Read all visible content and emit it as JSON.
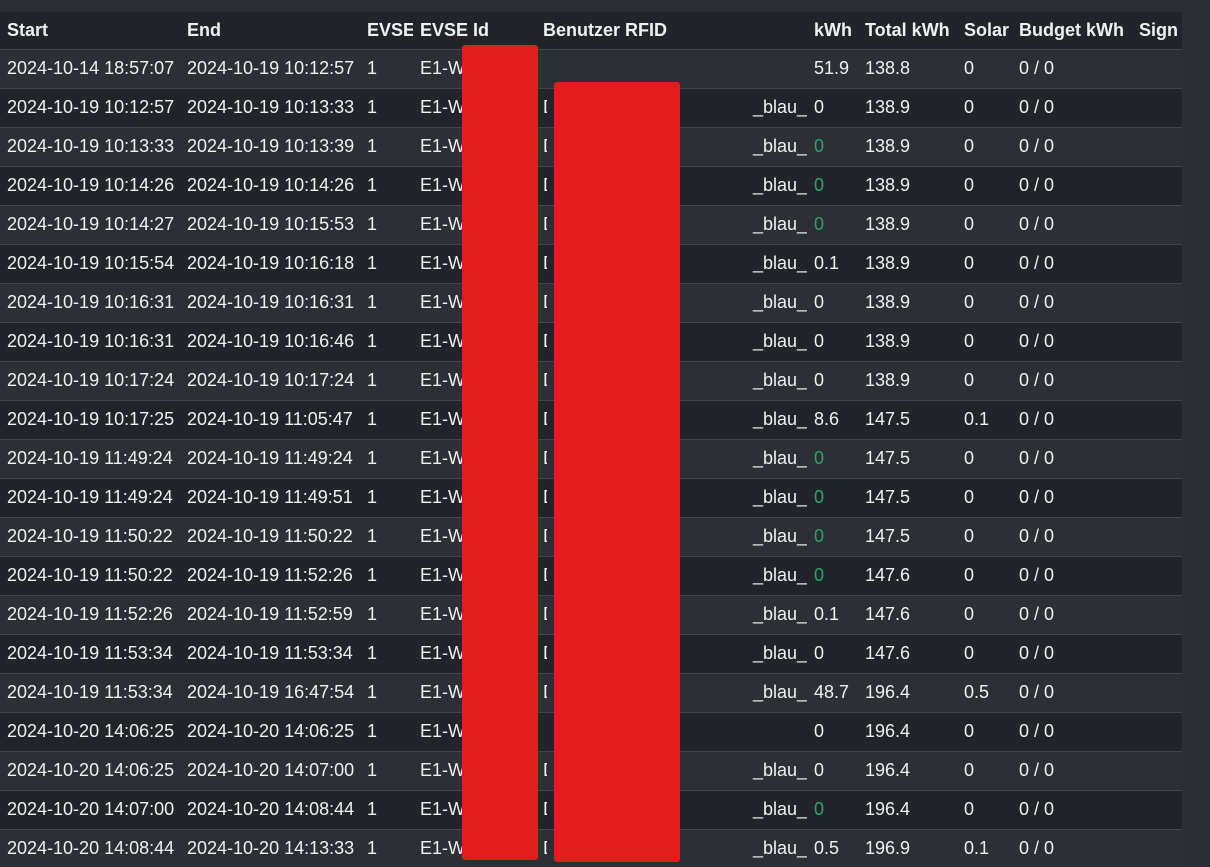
{
  "headers": {
    "start": "Start",
    "end": "End",
    "evse": "EVSE",
    "evse_id": "EVSE Id",
    "user_rfid": "Benutzer RFID",
    "kwh": "kWh",
    "total_kwh": "Total kWh",
    "solar": "Solar",
    "budget_kwh": "Budget kWh",
    "sign": "Sign"
  },
  "rows": [
    {
      "start": "2024-10-14 18:57:07",
      "end": "2024-10-19 10:12:57",
      "evse": "1",
      "evse_id": "E1-W",
      "rfid_a": "",
      "rfid_b": "",
      "kwh": "51.9",
      "total": "138.8",
      "solar": "0",
      "budget": "0 / 0",
      "sign": ""
    },
    {
      "start": "2024-10-19 10:12:57",
      "end": "2024-10-19 10:13:33",
      "evse": "1",
      "evse_id": "E1-W",
      "rfid_a": "D",
      "rfid_b": "_blau_",
      "kwh": "0",
      "total": "138.9",
      "solar": "0",
      "budget": "0 / 0",
      "sign": ""
    },
    {
      "start": "2024-10-19 10:13:33",
      "end": "2024-10-19 10:13:39",
      "evse": "1",
      "evse_id": "E1-W",
      "rfid_a": "D",
      "rfid_b": "_blau_",
      "kwh": "0",
      "kwh_green": true,
      "total": "138.9",
      "solar": "0",
      "budget": "0 / 0",
      "sign": ""
    },
    {
      "start": "2024-10-19 10:14:26",
      "end": "2024-10-19 10:14:26",
      "evse": "1",
      "evse_id": "E1-W",
      "rfid_a": "D",
      "rfid_b": "_blau_",
      "kwh": "0",
      "kwh_green": true,
      "total": "138.9",
      "solar": "0",
      "budget": "0 / 0",
      "sign": ""
    },
    {
      "start": "2024-10-19 10:14:27",
      "end": "2024-10-19 10:15:53",
      "evse": "1",
      "evse_id": "E1-W",
      "rfid_a": "D",
      "rfid_b": "_blau_",
      "kwh": "0",
      "kwh_green": true,
      "total": "138.9",
      "solar": "0",
      "budget": "0 / 0",
      "sign": ""
    },
    {
      "start": "2024-10-19 10:15:54",
      "end": "2024-10-19 10:16:18",
      "evse": "1",
      "evse_id": "E1-W",
      "rfid_a": "D",
      "rfid_b": "_blau_",
      "kwh": "0.1",
      "total": "138.9",
      "solar": "0",
      "budget": "0 / 0",
      "sign": ""
    },
    {
      "start": "2024-10-19 10:16:31",
      "end": "2024-10-19 10:16:31",
      "evse": "1",
      "evse_id": "E1-W",
      "rfid_a": "D",
      "rfid_b": "_blau_",
      "kwh": "0",
      "total": "138.9",
      "solar": "0",
      "budget": "0 / 0",
      "sign": ""
    },
    {
      "start": "2024-10-19 10:16:31",
      "end": "2024-10-19 10:16:46",
      "evse": "1",
      "evse_id": "E1-W",
      "rfid_a": "D",
      "rfid_b": "_blau_",
      "kwh": "0",
      "total": "138.9",
      "solar": "0",
      "budget": "0 / 0",
      "sign": ""
    },
    {
      "start": "2024-10-19 10:17:24",
      "end": "2024-10-19 10:17:24",
      "evse": "1",
      "evse_id": "E1-W",
      "rfid_a": "D",
      "rfid_b": "_blau_",
      "kwh": "0",
      "total": "138.9",
      "solar": "0",
      "budget": "0 / 0",
      "sign": ""
    },
    {
      "start": "2024-10-19 10:17:25",
      "end": "2024-10-19 11:05:47",
      "evse": "1",
      "evse_id": "E1-W",
      "rfid_a": "D",
      "rfid_b": "_blau_",
      "kwh": "8.6",
      "total": "147.5",
      "solar": "0.1",
      "budget": "0 / 0",
      "sign": ""
    },
    {
      "start": "2024-10-19 11:49:24",
      "end": "2024-10-19 11:49:24",
      "evse": "1",
      "evse_id": "E1-W",
      "rfid_a": "D",
      "rfid_b": "_blau_",
      "kwh": "0",
      "kwh_green": true,
      "total": "147.5",
      "solar": "0",
      "budget": "0 / 0",
      "sign": ""
    },
    {
      "start": "2024-10-19 11:49:24",
      "end": "2024-10-19 11:49:51",
      "evse": "1",
      "evse_id": "E1-W",
      "rfid_a": "D",
      "rfid_b": "_blau_",
      "kwh": "0",
      "kwh_green": true,
      "total": "147.5",
      "solar": "0",
      "budget": "0 / 0",
      "sign": ""
    },
    {
      "start": "2024-10-19 11:50:22",
      "end": "2024-10-19 11:50:22",
      "evse": "1",
      "evse_id": "E1-W",
      "rfid_a": "D",
      "rfid_b": "_blau_",
      "kwh": "0",
      "kwh_green": true,
      "total": "147.5",
      "solar": "0",
      "budget": "0 / 0",
      "sign": ""
    },
    {
      "start": "2024-10-19 11:50:22",
      "end": "2024-10-19 11:52:26",
      "evse": "1",
      "evse_id": "E1-W",
      "rfid_a": "D",
      "rfid_b": "_blau_",
      "kwh": "0",
      "kwh_green": true,
      "total": "147.6",
      "solar": "0",
      "budget": "0 / 0",
      "sign": ""
    },
    {
      "start": "2024-10-19 11:52:26",
      "end": "2024-10-19 11:52:59",
      "evse": "1",
      "evse_id": "E1-W",
      "rfid_a": "D",
      "rfid_b": "_blau_",
      "kwh": "0.1",
      "total": "147.6",
      "solar": "0",
      "budget": "0 / 0",
      "sign": ""
    },
    {
      "start": "2024-10-19 11:53:34",
      "end": "2024-10-19 11:53:34",
      "evse": "1",
      "evse_id": "E1-W",
      "rfid_a": "D",
      "rfid_b": "_blau_",
      "kwh": "0",
      "total": "147.6",
      "solar": "0",
      "budget": "0 / 0",
      "sign": ""
    },
    {
      "start": "2024-10-19 11:53:34",
      "end": "2024-10-19 16:47:54",
      "evse": "1",
      "evse_id": "E1-W",
      "rfid_a": "D",
      "rfid_b": "_blau_",
      "kwh": "48.7",
      "total": "196.4",
      "solar": "0.5",
      "budget": "0 / 0",
      "sign": ""
    },
    {
      "start": "2024-10-20 14:06:25",
      "end": "2024-10-20 14:06:25",
      "evse": "1",
      "evse_id": "E1-W",
      "rfid_a": "",
      "rfid_b": "",
      "kwh": "0",
      "total": "196.4",
      "solar": "0",
      "budget": "0 / 0",
      "sign": ""
    },
    {
      "start": "2024-10-20 14:06:25",
      "end": "2024-10-20 14:07:00",
      "evse": "1",
      "evse_id": "E1-W",
      "rfid_a": "D",
      "rfid_b": "_blau_",
      "kwh": "0",
      "total": "196.4",
      "solar": "0",
      "budget": "0 / 0",
      "sign": ""
    },
    {
      "start": "2024-10-20 14:07:00",
      "end": "2024-10-20 14:08:44",
      "evse": "1",
      "evse_id": "E1-W",
      "rfid_a": "D",
      "rfid_b": "_blau_",
      "kwh": "0",
      "kwh_green": true,
      "total": "196.4",
      "solar": "0",
      "budget": "0 / 0",
      "sign": ""
    },
    {
      "start": "2024-10-20 14:08:44",
      "end": "2024-10-20 14:13:33",
      "evse": "1",
      "evse_id": "E1-W",
      "rfid_a": "D",
      "rfid_b": "_blau_",
      "kwh": "0.5",
      "total": "196.9",
      "solar": "0.1",
      "budget": "0 / 0",
      "sign": ""
    }
  ],
  "colors": {
    "table_bg": "#212529",
    "row_alt": "#2c3034",
    "green_value": "#2fa06a",
    "redaction": "#e31d1d"
  }
}
